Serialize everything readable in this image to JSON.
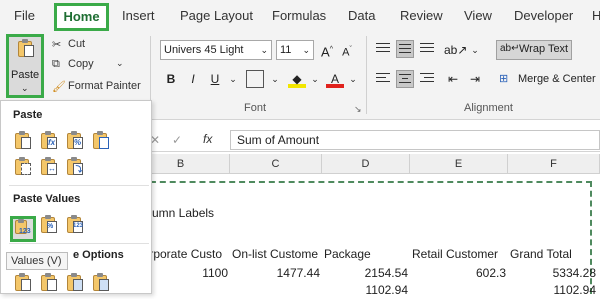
{
  "tabs": [
    "File",
    "Home",
    "Insert",
    "Page Layout",
    "Formulas",
    "Data",
    "Review",
    "View",
    "Developer",
    "H"
  ],
  "clipboard": {
    "paste_label": "Paste",
    "cut_label": "Cut",
    "copy_label": "Copy",
    "format_painter_label": "Format Painter"
  },
  "font": {
    "family": "Univers 45 Light",
    "size": "11",
    "group_label": "Font",
    "bold": "B",
    "italic": "I",
    "underline": "U",
    "grow": "A",
    "shrink": "A",
    "fill_letter": "",
    "color_letter": "A"
  },
  "alignment": {
    "wrap_text_label": "Wrap Text",
    "merge_center_label": "Merge & Center",
    "group_label": "Alignment"
  },
  "formula_bar": {
    "cancel": "✕",
    "enter": "✓",
    "fx": "fx",
    "value": "Sum of Amount"
  },
  "columns": [
    "B",
    "C",
    "D",
    "E",
    "F"
  ],
  "sheet": {
    "column_labels": "Column Labels",
    "headers": [
      "Corporate Custo",
      "On-list Custome",
      "Package",
      "Retail Customer",
      "Grand Total"
    ],
    "row1": [
      "1100",
      "1477.44",
      "2154.54",
      "602.3",
      "5334.28"
    ],
    "row2": [
      "",
      "",
      "1102.94",
      "",
      "1102.94"
    ]
  },
  "paste_menu": {
    "paste_heading": "Paste",
    "paste_values_heading": "Paste Values",
    "other_heading": "Other Paste Options",
    "other_heading_visible": "e Options",
    "tooltip": "Values (V)",
    "selected_badge": "123",
    "pv_badge2": "%",
    "pv_badge3": "123"
  },
  "colors": {
    "accent": "#3aaa48",
    "ribbon_bg": "#f3f3f3",
    "marquee": "#4f8a5e"
  }
}
